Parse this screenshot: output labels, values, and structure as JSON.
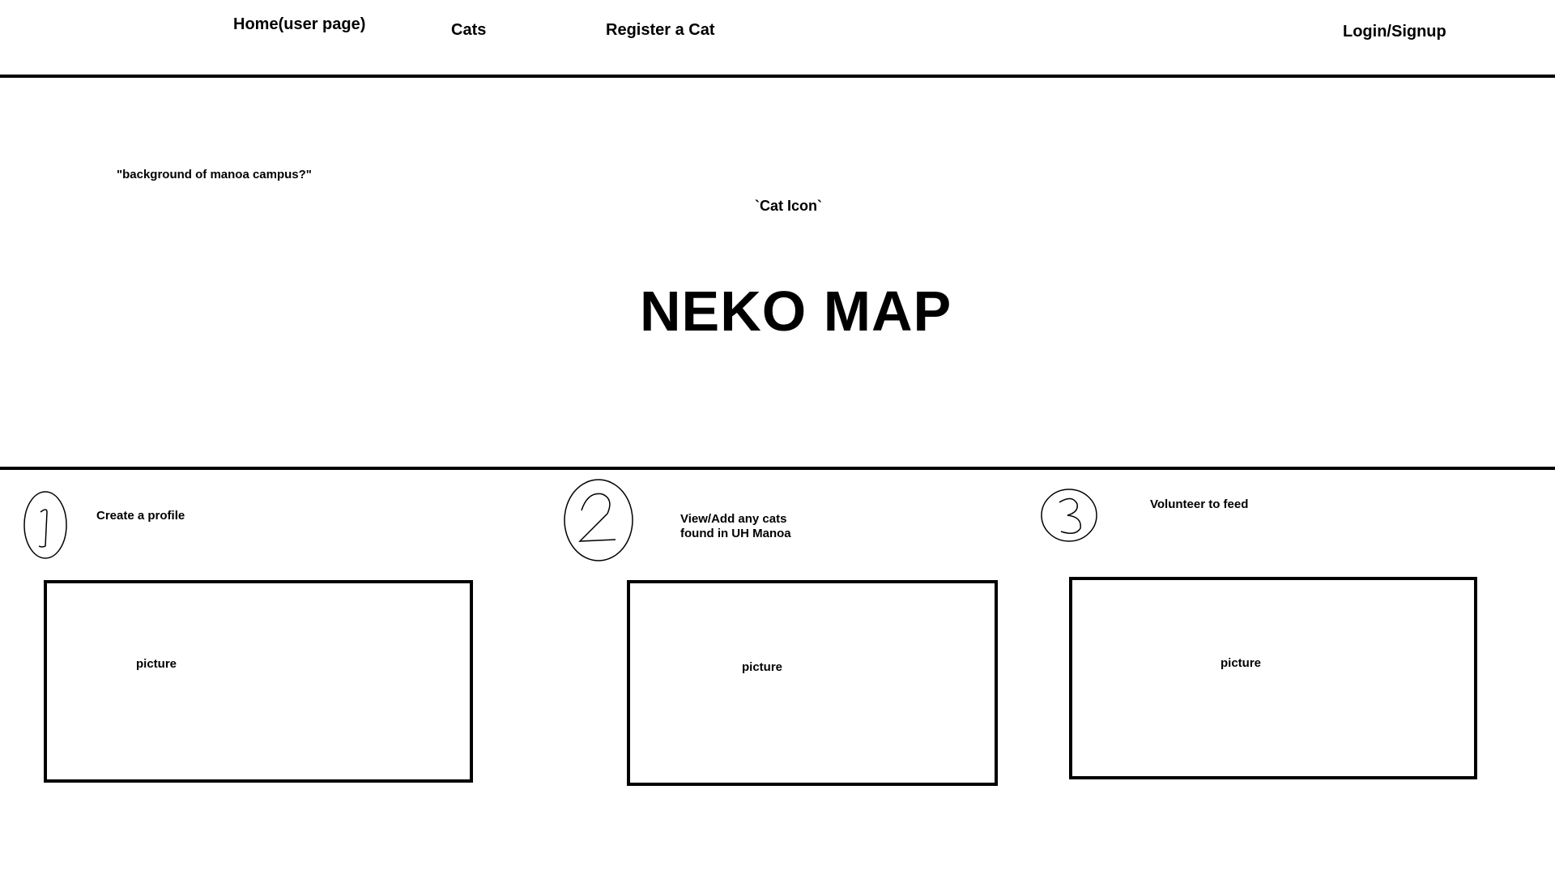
{
  "nav": {
    "home": "Home(user page)",
    "cats": "Cats",
    "register": "Register a Cat",
    "login": "Login/Signup"
  },
  "hero": {
    "background_note": "\"background of manoa campus?\"",
    "cat_icon_placeholder": "`Cat Icon`",
    "title": "NEKO MAP"
  },
  "steps": [
    {
      "number": "1",
      "title": "Create a profile",
      "picture_label": "picture"
    },
    {
      "number": "2",
      "title_line1": "View/Add any cats",
      "title_line2": "found in UH Manoa",
      "picture_label": "picture"
    },
    {
      "number": "3",
      "title": "Volunteer to feed",
      "picture_label": "picture"
    }
  ]
}
